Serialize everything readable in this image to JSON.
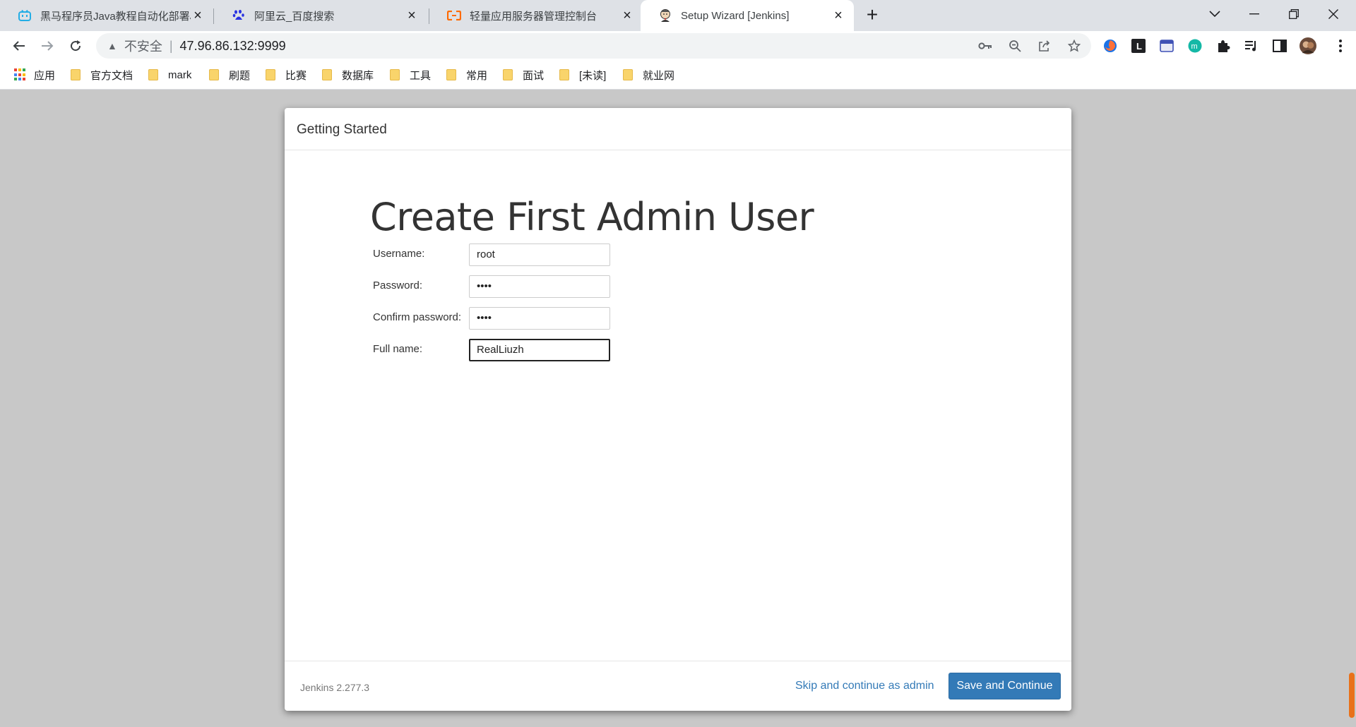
{
  "browser": {
    "tabs": [
      {
        "title": "黑马程序员Java教程自动化部署J",
        "icon": "bilibili-icon",
        "active": false
      },
      {
        "title": "阿里云_百度搜索",
        "icon": "baidu-paw-icon",
        "active": false
      },
      {
        "title": "轻量应用服务器管理控制台",
        "icon": "aliyun-icon",
        "active": false
      },
      {
        "title": "Setup Wizard [Jenkins]",
        "icon": "jenkins-icon",
        "active": true
      }
    ],
    "address_bar": {
      "security_label": "不安全",
      "url": "47.96.86.132:9999"
    },
    "bookmarks": [
      {
        "label": "应用",
        "type": "apps"
      },
      {
        "label": "官方文档",
        "type": "folder"
      },
      {
        "label": "mark",
        "type": "folder"
      },
      {
        "label": "刷题",
        "type": "folder"
      },
      {
        "label": "比赛",
        "type": "folder"
      },
      {
        "label": "数据库",
        "type": "folder"
      },
      {
        "label": "工具",
        "type": "folder"
      },
      {
        "label": "常用",
        "type": "folder"
      },
      {
        "label": "面试",
        "type": "folder"
      },
      {
        "label": "[未读]",
        "type": "folder"
      },
      {
        "label": "就业网",
        "type": "folder"
      }
    ]
  },
  "wizard": {
    "header": "Getting Started",
    "heading": "Create First Admin User",
    "fields": {
      "username": {
        "label": "Username:",
        "value": "root"
      },
      "password": {
        "label": "Password:",
        "value": "••••"
      },
      "confirm_password": {
        "label": "Confirm password:",
        "value": "••••"
      },
      "full_name": {
        "label": "Full name:",
        "value": "RealLiuzh"
      }
    },
    "footer": {
      "version": "Jenkins 2.277.3",
      "skip_label": "Skip and continue as admin",
      "save_label": "Save and Continue"
    }
  },
  "colors": {
    "primary_button": "#337ab7",
    "link": "#337ab7",
    "page_background": "#c8c8c8"
  }
}
